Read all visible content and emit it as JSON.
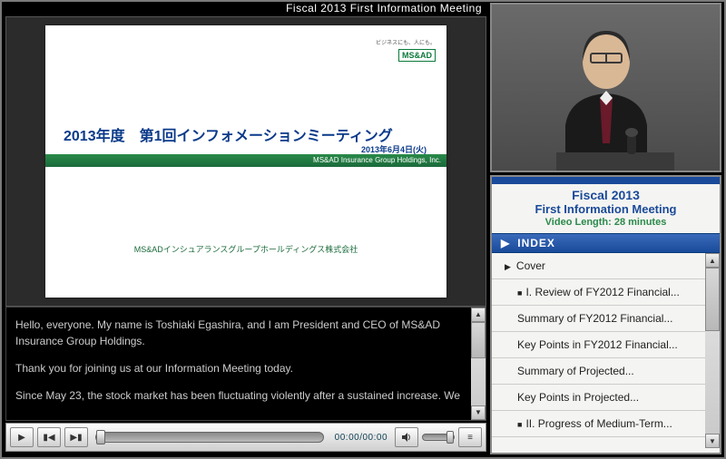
{
  "window_title": "Fiscal 2013 First Information Meeting",
  "slide": {
    "logo_small": "ビジネスにも、人にも。",
    "logo_text": "MS&AD",
    "title": "2013年度　第1回インフォメーションミーティング",
    "date": "2013年6月4日(火)",
    "band": "MS&AD Insurance Group Holdings, Inc.",
    "company": "MS&ADインシュアランスグループホールディングス株式会社"
  },
  "transcript": {
    "p1": "Hello, everyone. My name is Toshiaki Egashira, and I am President and CEO of MS&AD Insurance Group Holdings.",
    "p2": "Thank you for joining us at our Information Meeting today.",
    "p3": "Since May 23, the stock market has been fluctuating violently after a sustained increase. We"
  },
  "player": {
    "time": "00:00/00:00"
  },
  "info": {
    "title1": "Fiscal 2013",
    "title2": "First Information Meeting",
    "video_length": "Video Length: 28 minutes",
    "index_label": "INDEX",
    "toc": {
      "cover": "Cover",
      "i_review": "I. Review of FY2012 Financial...",
      "summary_2012": "Summary of FY2012 Financial...",
      "keypoints_2012": "Key Points in FY2012 Financial...",
      "summary_proj": "Summary of Projected...",
      "keypoints_proj": "Key Points in Projected...",
      "ii_progress": "II. Progress of Medium-Term..."
    }
  }
}
